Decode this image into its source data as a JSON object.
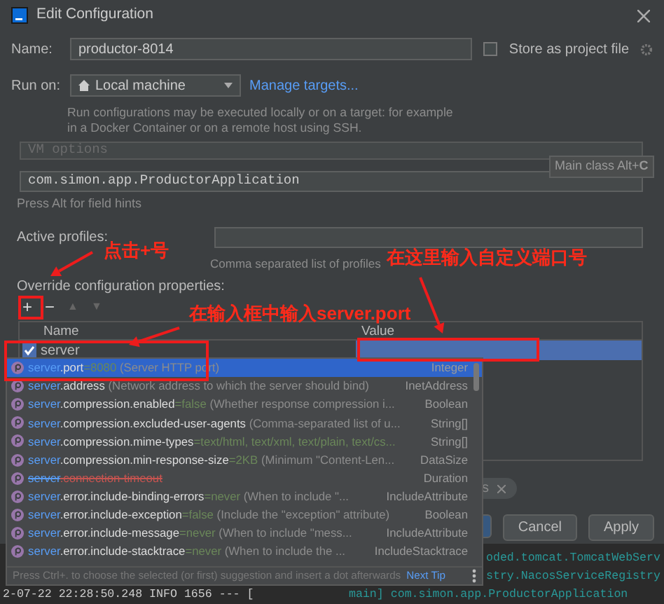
{
  "window": {
    "title": "Edit Configuration"
  },
  "name_field": {
    "label": "Name:",
    "value": "productor-8014"
  },
  "store_as_project_file": {
    "label": "Store as project file",
    "checked": false
  },
  "run_on": {
    "label": "Run on:",
    "value": "Local machine",
    "link": "Manage targets..."
  },
  "run_on_hint": "Run configurations may be executed locally or on a target: for example in a Docker Container or on a remote host using SSH.",
  "vm_options": {
    "placeholder": "VM options"
  },
  "main_class": {
    "value": "com.simon.app.ProductorApplication"
  },
  "tooltip": "Main class Alt+**C**",
  "field_hints": "Press Alt for field hints",
  "active_profiles": {
    "label": "Active profiles:",
    "hint": "Comma separated list of profiles"
  },
  "override": {
    "label": "Override configuration properties:",
    "toolbar": [
      {
        "symbol": "+",
        "disabled": false
      },
      {
        "symbol": "−",
        "disabled": false
      },
      {
        "symbol": "▲",
        "disabled": true
      },
      {
        "symbol": "▼",
        "disabled": true
      }
    ],
    "columns": [
      "Name",
      "Value"
    ],
    "rows": [
      {
        "name": "server",
        "checked": true,
        "selected": true
      }
    ]
  },
  "completion": {
    "items": [
      {
        "prefix": "server",
        "name": ".port",
        "default": "=8080",
        "description": "(Server HTTP port)",
        "type": "Integer",
        "deprecated": false,
        "selected": true
      },
      {
        "prefix": "server",
        "name": ".address",
        "description": "(Network address to which the server should bind)",
        "type": "InetAddress",
        "deprecated": false,
        "selected": false
      },
      {
        "prefix": "server",
        "name": ".compression.enabled",
        "default": "=false",
        "description": "(Whether response compression i...",
        "type": "Boolean",
        "deprecated": false,
        "selected": false
      },
      {
        "prefix": "server",
        "name": ".compression.excluded-user-agents",
        "description": "(Comma-separated list of u...",
        "type": "String[]",
        "deprecated": false,
        "selected": false
      },
      {
        "prefix": "server",
        "name": ".compression.mime-types",
        "default": "=text/html, text/xml, text/plain, text/cs...",
        "type": "String[]",
        "deprecated": false,
        "selected": false
      },
      {
        "prefix": "server",
        "name": ".compression.min-response-size",
        "default": "=2KB",
        "description": "(Minimum \"Content-Len...",
        "type": "DataSize",
        "deprecated": false,
        "selected": false
      },
      {
        "prefix": "server",
        "name": ".connection-timeout",
        "type": "Duration",
        "deprecated": true,
        "selected": false
      },
      {
        "prefix": "server",
        "name": ".error.include-binding-errors",
        "default": "=never",
        "description": "(When to include \"...",
        "type": "IncludeAttribute",
        "deprecated": false,
        "selected": false
      },
      {
        "prefix": "server",
        "name": ".error.include-exception",
        "default": "=false",
        "description": "(Include the \"exception\" attribute)",
        "type": "Boolean",
        "deprecated": false,
        "selected": false
      },
      {
        "prefix": "server",
        "name": ".error.include-message",
        "default": "=never",
        "description": "(When to include \"mess...",
        "type": "IncludeAttribute",
        "deprecated": false,
        "selected": false
      },
      {
        "prefix": "server",
        "name": ".error.include-stacktrace",
        "default": "=never",
        "description": "(When to include the ...",
        "type": "IncludeStacktrace",
        "deprecated": false,
        "selected": false
      }
    ],
    "footer": "Press Ctrl+. to choose the selected (or first) suggestion and insert a dot afterwards",
    "footer_link": "Next Tip"
  },
  "chip": {
    "text": "s"
  },
  "buttons": [
    {
      "label": "Cancel",
      "primary": false
    },
    {
      "label": "Apply",
      "primary": false
    }
  ],
  "console": [
    {
      "right": "oded.tomcat.TomcatWebServ"
    },
    {
      "right": "stry.NacosServiceRegistry"
    },
    {
      "left": "2-07-22 22:28:50.248  INFO 1656 --- [",
      "right": "main] com.simon.app.ProductorApplication"
    }
  ],
  "annotations": [
    {
      "text": "点击+号"
    },
    {
      "text": "在这里输入自定义端口号"
    },
    {
      "text": "在输入框中输入server.port"
    }
  ]
}
